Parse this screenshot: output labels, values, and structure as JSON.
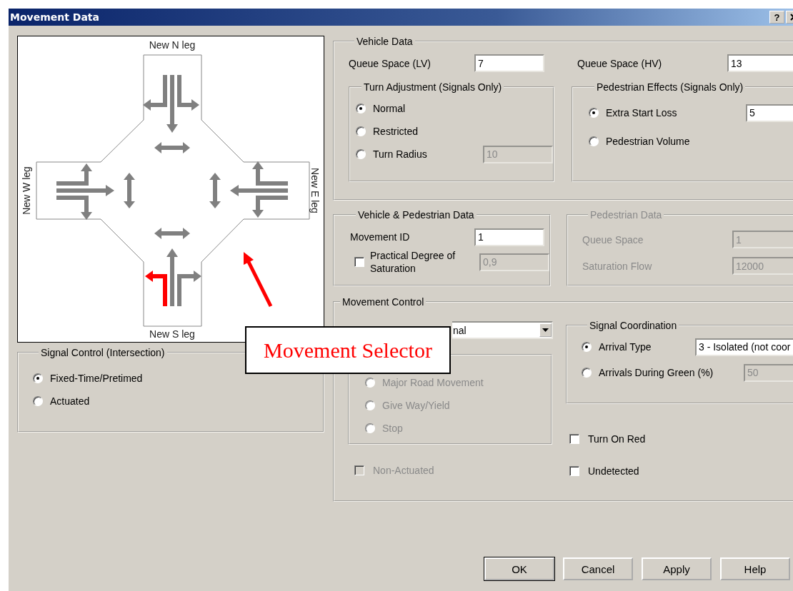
{
  "window": {
    "title": "Movement Data",
    "help_button": "?"
  },
  "diagram": {
    "legs": [
      {
        "label": "New N leg",
        "movements": [
          {
            "selected": false
          },
          {
            "selected": false
          },
          {
            "selected": false
          }
        ],
        "crossing": {
          "selected": false
        }
      },
      {
        "label": "New W leg",
        "movements": [
          {
            "selected": false
          },
          {
            "selected": false
          },
          {
            "selected": false
          }
        ],
        "crossing": {
          "selected": false
        }
      },
      {
        "label": "New E leg",
        "movements": [
          {
            "selected": false
          },
          {
            "selected": false
          },
          {
            "selected": false
          }
        ],
        "crossing": {
          "selected": false
        }
      },
      {
        "label": "New S leg",
        "movements": [
          {
            "selected": true
          },
          {
            "selected": false
          },
          {
            "selected": false
          }
        ],
        "crossing": {
          "selected": false
        }
      }
    ],
    "callout": "Movement Selector"
  },
  "signal_control": {
    "title": "Signal Control (Intersection)",
    "options": [
      {
        "label": "Fixed-Time/Pretimed",
        "selected": true
      },
      {
        "label": "Actuated",
        "selected": false
      }
    ]
  },
  "vehicle_data": {
    "title": "Vehicle Data",
    "queue_space_lv": {
      "label": "Queue Space (LV)",
      "value": "7"
    },
    "queue_space_hv": {
      "label": "Queue Space (HV)",
      "value": "13"
    },
    "turn_adjustment": {
      "title": "Turn Adjustment (Signals Only)",
      "options": [
        {
          "label": "Normal",
          "selected": true
        },
        {
          "label": "Restricted",
          "selected": false
        },
        {
          "label": "Turn Radius",
          "selected": false,
          "value": "10",
          "disabled": true
        }
      ]
    },
    "pedestrian_effects": {
      "title": "Pedestrian Effects (Signals Only)",
      "options": [
        {
          "label": "Extra Start Loss",
          "selected": true,
          "value": "5",
          "disabled": false
        },
        {
          "label": "Pedestrian Volume",
          "selected": false
        }
      ]
    }
  },
  "vehicle_pedestrian_data": {
    "title": "Vehicle & Pedestrian Data",
    "movement_id": {
      "label": "Movement ID",
      "value": "1"
    },
    "practical_degree": {
      "label": "Practical Degree of Saturation",
      "checked": false,
      "value": "0,9",
      "disabled": true
    }
  },
  "pedestrian_data": {
    "title": "Pedestrian Data",
    "disabled": true,
    "fields": [
      {
        "label": "Queue Space",
        "value": "1"
      },
      {
        "label": "Saturation Flow",
        "value": "12000"
      }
    ]
  },
  "movement_control": {
    "title": "Movement Control",
    "dropdown": "nal",
    "control_type": {
      "disabled": true,
      "options": [
        {
          "label": "Major Road Movement",
          "selected": false
        },
        {
          "label": "Give Way/Yield",
          "selected": false
        },
        {
          "label": "Stop",
          "selected": false
        }
      ]
    },
    "non_actuated": {
      "label": "Non-Actuated",
      "checked": false,
      "disabled": true
    },
    "signal_coordination": {
      "title": "Signal Coordination",
      "options": [
        {
          "kind": "dropdown",
          "label": "Arrival Type",
          "selected": true,
          "value": "3 - Isolated (not coor"
        },
        {
          "kind": "field",
          "label": "Arrivals During Green (%)",
          "selected": false,
          "value": "50",
          "disabled": true
        }
      ]
    },
    "checkboxes": [
      {
        "label": "Turn On Red",
        "checked": false
      },
      {
        "label": "Undetected",
        "checked": false
      }
    ]
  },
  "buttons": [
    {
      "label": "OK",
      "default": true
    },
    {
      "label": "Cancel",
      "default": false
    },
    {
      "label": "Apply",
      "default": false
    },
    {
      "label": "Help",
      "default": false
    }
  ]
}
